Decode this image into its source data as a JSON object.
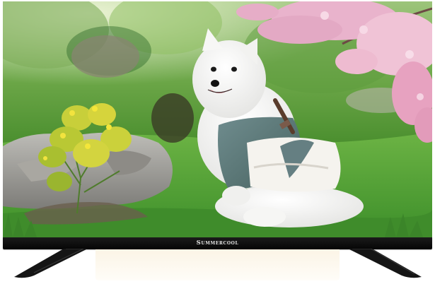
{
  "tv": {
    "brand": "Summercool"
  },
  "scene": {
    "subject": "white-spitz-dog-in-clothes",
    "colors": {
      "grass": "#5aa33a",
      "blossom": "#e8a6c2",
      "fur": "#f4f4f2",
      "coat": "#5f7c80",
      "rock": "#9a9894"
    }
  }
}
